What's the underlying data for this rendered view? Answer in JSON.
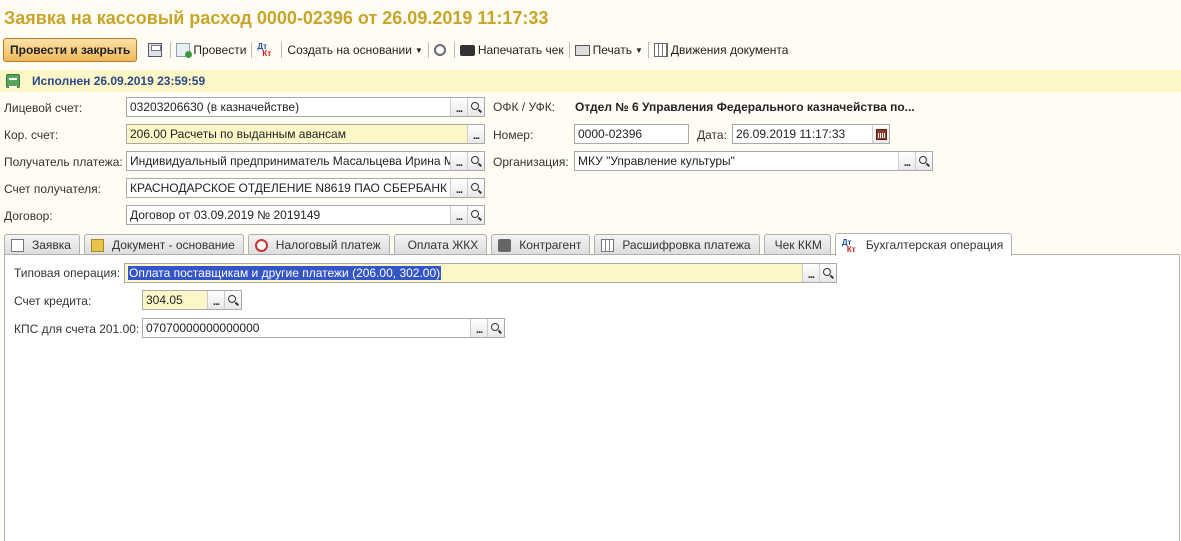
{
  "title": "Заявка на кассовый расход 0000-02396 от 26.09.2019 11:17:33",
  "toolbar": {
    "post_and_close": "Провести и закрыть",
    "post": "Провести",
    "create_based_on": "Создать на основании",
    "print_receipt": "Напечатать чек",
    "print": "Печать",
    "document_movements": "Движения документа"
  },
  "status": {
    "text": "Исполнен 26.09.2019 23:59:59"
  },
  "form": {
    "personal_account": {
      "label": "Лицевой счет:",
      "value": "03203206630 (в казначействе)"
    },
    "corr_account": {
      "label": "Кор. счет:",
      "value": "206.00 Расчеты по выданным авансам"
    },
    "payee": {
      "label": "Получатель платежа:",
      "value": "Индивидуальный предприниматель Масальцева Ирина М"
    },
    "payee_account": {
      "label": "Счет получателя:",
      "value": "КРАСНОДАРСКОЕ ОТДЕЛЕНИЕ N8619 ПАО СБЕРБАНК"
    },
    "contract": {
      "label": "Договор:",
      "value": "Договор от 03.09.2019 № 2019149"
    },
    "ofk": {
      "label": "ОФК / УФК:",
      "value": "Отдел № 6 Управления Федерального казначейства по..."
    },
    "number": {
      "label": "Номер:",
      "value": "0000-02396"
    },
    "date": {
      "label": "Дата:",
      "value": "26.09.2019 11:17:33"
    },
    "organization": {
      "label": "Организация:",
      "value": "МКУ \"Управление культуры\""
    }
  },
  "tabs": [
    {
      "label": "Заявка",
      "icon": "document-icon"
    },
    {
      "label": "Документ - основание",
      "icon": "base-document-icon"
    },
    {
      "label": "Налоговый платеж",
      "icon": "tax-icon"
    },
    {
      "label": "Оплата ЖКХ",
      "icon": ""
    },
    {
      "label": "Контрагент",
      "icon": "counterparty-icon"
    },
    {
      "label": "Расшифровка платежа",
      "icon": "table-icon"
    },
    {
      "label": "Чек ККМ",
      "icon": ""
    },
    {
      "label": "Бухгалтерская операция",
      "icon": "debit-credit-icon",
      "active": true
    }
  ],
  "accounting": {
    "typical_operation": {
      "label": "Типовая операция:",
      "value": "Оплата поставщикам и другие платежи (206.00, 302.00)"
    },
    "credit_account": {
      "label": "Счет кредита:",
      "value": "304.05"
    },
    "kps": {
      "label": "КПС для счета 201.00:",
      "value": "07070000000000000"
    }
  },
  "icon_labels": {
    "debit": "Дт",
    "credit": "Кт"
  },
  "colors": {
    "title": "#c8a52a",
    "status": "#2a4a8a",
    "highlight": "#fdf7c8",
    "selection": "#3355c8"
  }
}
